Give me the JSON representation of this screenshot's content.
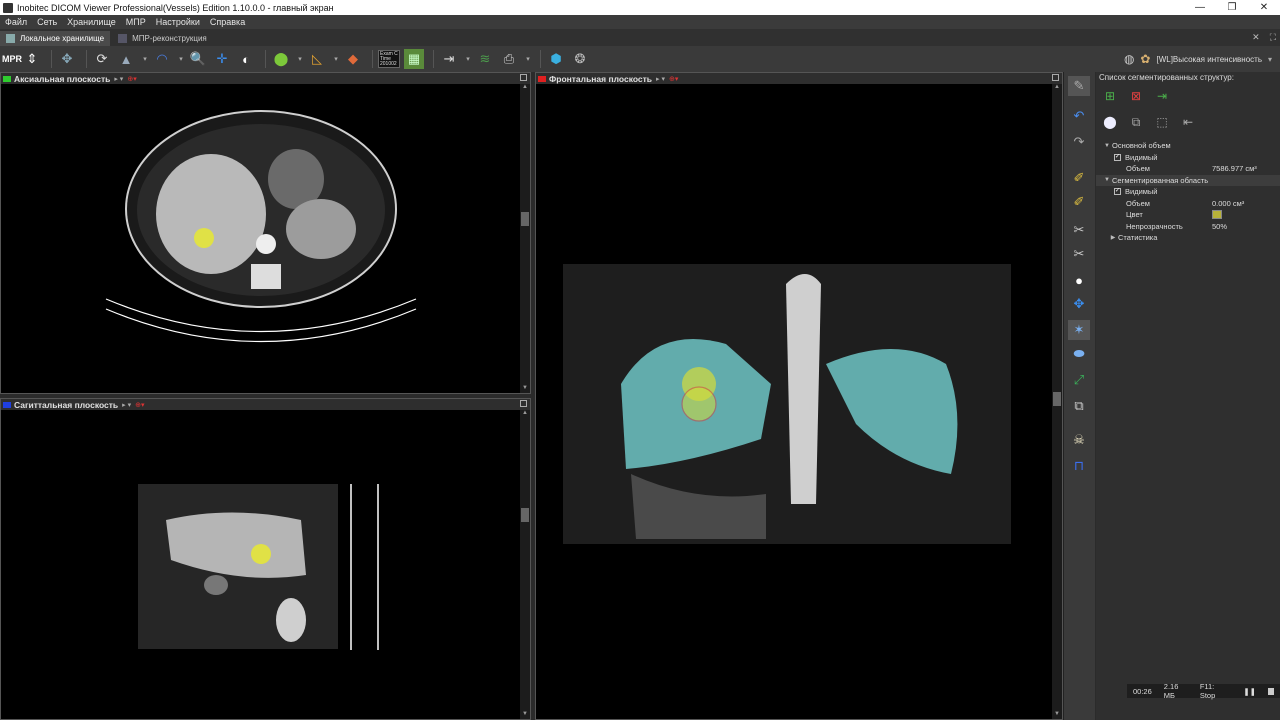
{
  "window": {
    "title": "Inobitec DICOM Viewer Professional(Vessels) Edition 1.10.0.0 - главный экран",
    "controls": [
      "—",
      "❐",
      "✕"
    ]
  },
  "menu": [
    "Файл",
    "Сеть",
    "Хранилище",
    "МПР",
    "Настройки",
    "Справка"
  ],
  "tabs": [
    {
      "label": "Локальное хранилище",
      "active": true
    },
    {
      "label": "МПР-реконструкция",
      "active": false
    }
  ],
  "tab_controls": [
    "✕",
    "⛶"
  ],
  "toolbar": {
    "mpr_label": "MPR",
    "exam_box": "Exam C Time 201002",
    "preset_label": "[WL]Высокая интенсивность"
  },
  "panels": {
    "axial": {
      "title": "Аксиальная плоскость",
      "color": "#2fcc2f"
    },
    "sagittal": {
      "title": "Сагиттальная плоскость",
      "color": "#1f3fe0"
    },
    "frontal": {
      "title": "Фронтальная плоскость",
      "color": "#e02020"
    }
  },
  "side_panel": {
    "title": "Список сегментированных структур:",
    "tree": {
      "base_volume": {
        "label": "Основной объем",
        "visible_label": "Видимый",
        "volume_label": "Объем",
        "volume_value": "7586.977 см³"
      },
      "segmented_region": {
        "label": "Сегментированная область",
        "visible_label": "Видимый",
        "volume_label": "Объем",
        "volume_value": "0.000 см³",
        "color_label": "Цвет",
        "opacity_label": "Непрозрачность",
        "opacity_value": "50%",
        "stats_label": "Статистика"
      }
    },
    "seg_color": "#b8b23a"
  },
  "status": {
    "time": "00:26",
    "size": "2.16 МБ",
    "hotkey": "F11: Stop"
  }
}
